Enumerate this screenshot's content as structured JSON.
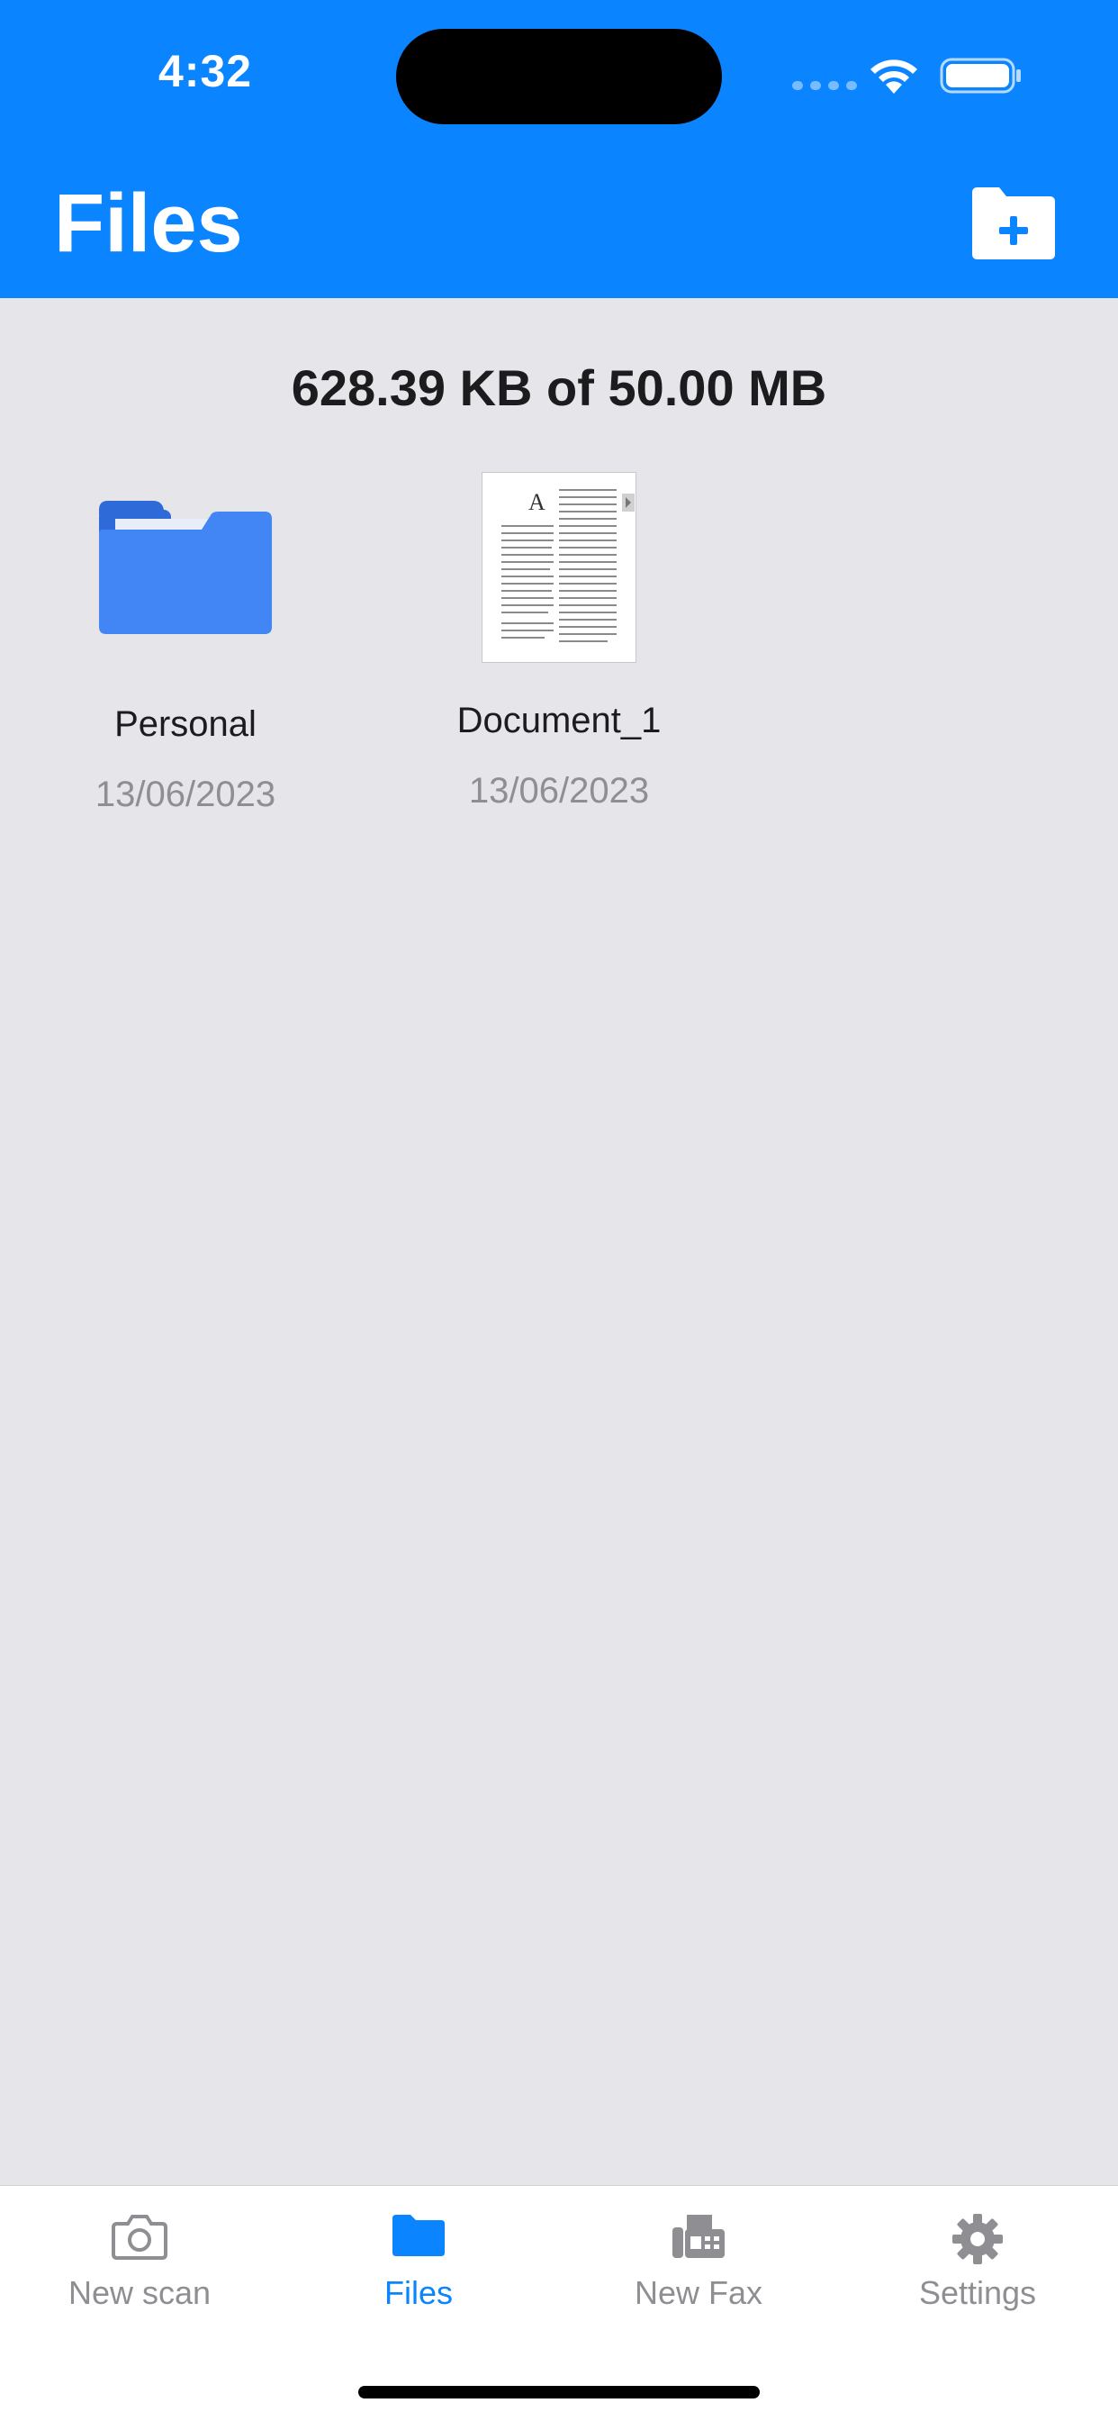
{
  "status_bar": {
    "time": "4:32"
  },
  "header": {
    "title": "Files"
  },
  "storage": {
    "label": "628.39 KB of 50.00 MB"
  },
  "items": [
    {
      "name": "Personal",
      "date": "13/06/2023",
      "kind": "folder-icon"
    },
    {
      "name": "Document_1",
      "date": "13/06/2023",
      "kind": "document-thumbnail"
    }
  ],
  "tab_bar": {
    "tabs": [
      {
        "label": "New scan",
        "icon": "camera-icon",
        "active": false
      },
      {
        "label": "Files",
        "icon": "folder-icon",
        "active": true
      },
      {
        "label": "New Fax",
        "icon": "fax-icon",
        "active": false
      },
      {
        "label": "Settings",
        "icon": "gear-icon",
        "active": false
      }
    ]
  },
  "colors": {
    "accent": "#0A84FF",
    "background": "#E5E5EA",
    "folder": "#4285F4",
    "inactive": "#8E8E93"
  }
}
